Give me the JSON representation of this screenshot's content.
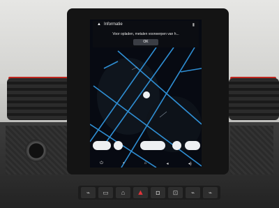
{
  "notification": {
    "title": "Informatie",
    "message": "Voor opladen, metalen voorwerpen van h...",
    "ok_label": "OK",
    "icon": "warning-triangle-icon"
  },
  "navbar": {
    "icons": [
      "power-icon",
      "menu-icon",
      "home-icon",
      "volume-down-icon",
      "volume-up-icon"
    ],
    "glyphs": [
      "⏻",
      "▪",
      "⌂",
      "◂",
      "◂)"
    ]
  },
  "map": {
    "road_color": "#2f8fd4"
  },
  "hardware_buttons": {
    "icons": [
      "eco-icon",
      "camera-icon",
      "lane-icon",
      "hazard-icon",
      "lock-icon",
      "parking-icon",
      "defrost-icon",
      "fan-icon"
    ],
    "glyphs": [
      "⌁",
      "▭",
      "⌂",
      "▲",
      "◘",
      "⊡",
      "⌁",
      "⌁"
    ]
  }
}
